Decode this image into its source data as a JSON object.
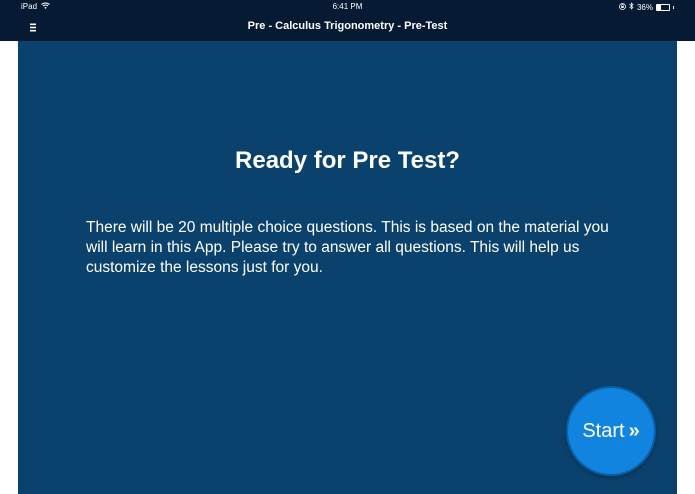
{
  "status_bar": {
    "device": "iPad",
    "wifi_icon": "wifi-icon",
    "time": "6:41 PM",
    "lock_icon": "orientation-lock-icon",
    "bluetooth_icon": "bluetooth-icon",
    "battery_percent": "36%",
    "battery_level": 0.36
  },
  "nav": {
    "menu_icon": "hamburger-menu-icon",
    "title": "Pre - Calculus Trigonometry - Pre-Test"
  },
  "main": {
    "heading": "Ready for Pre Test?",
    "body": "There will be 20 multiple choice questions. This is based on the material you will learn in this App. Please try to answer all questions. This will help us customize the lessons just for you.",
    "start_label": "Start",
    "start_icon": "double-chevron-right-icon",
    "start_glyph": "»"
  },
  "colors": {
    "nav_bg": "#061a33",
    "content_bg": "#0b426d",
    "button_bg": "#1184e0"
  }
}
